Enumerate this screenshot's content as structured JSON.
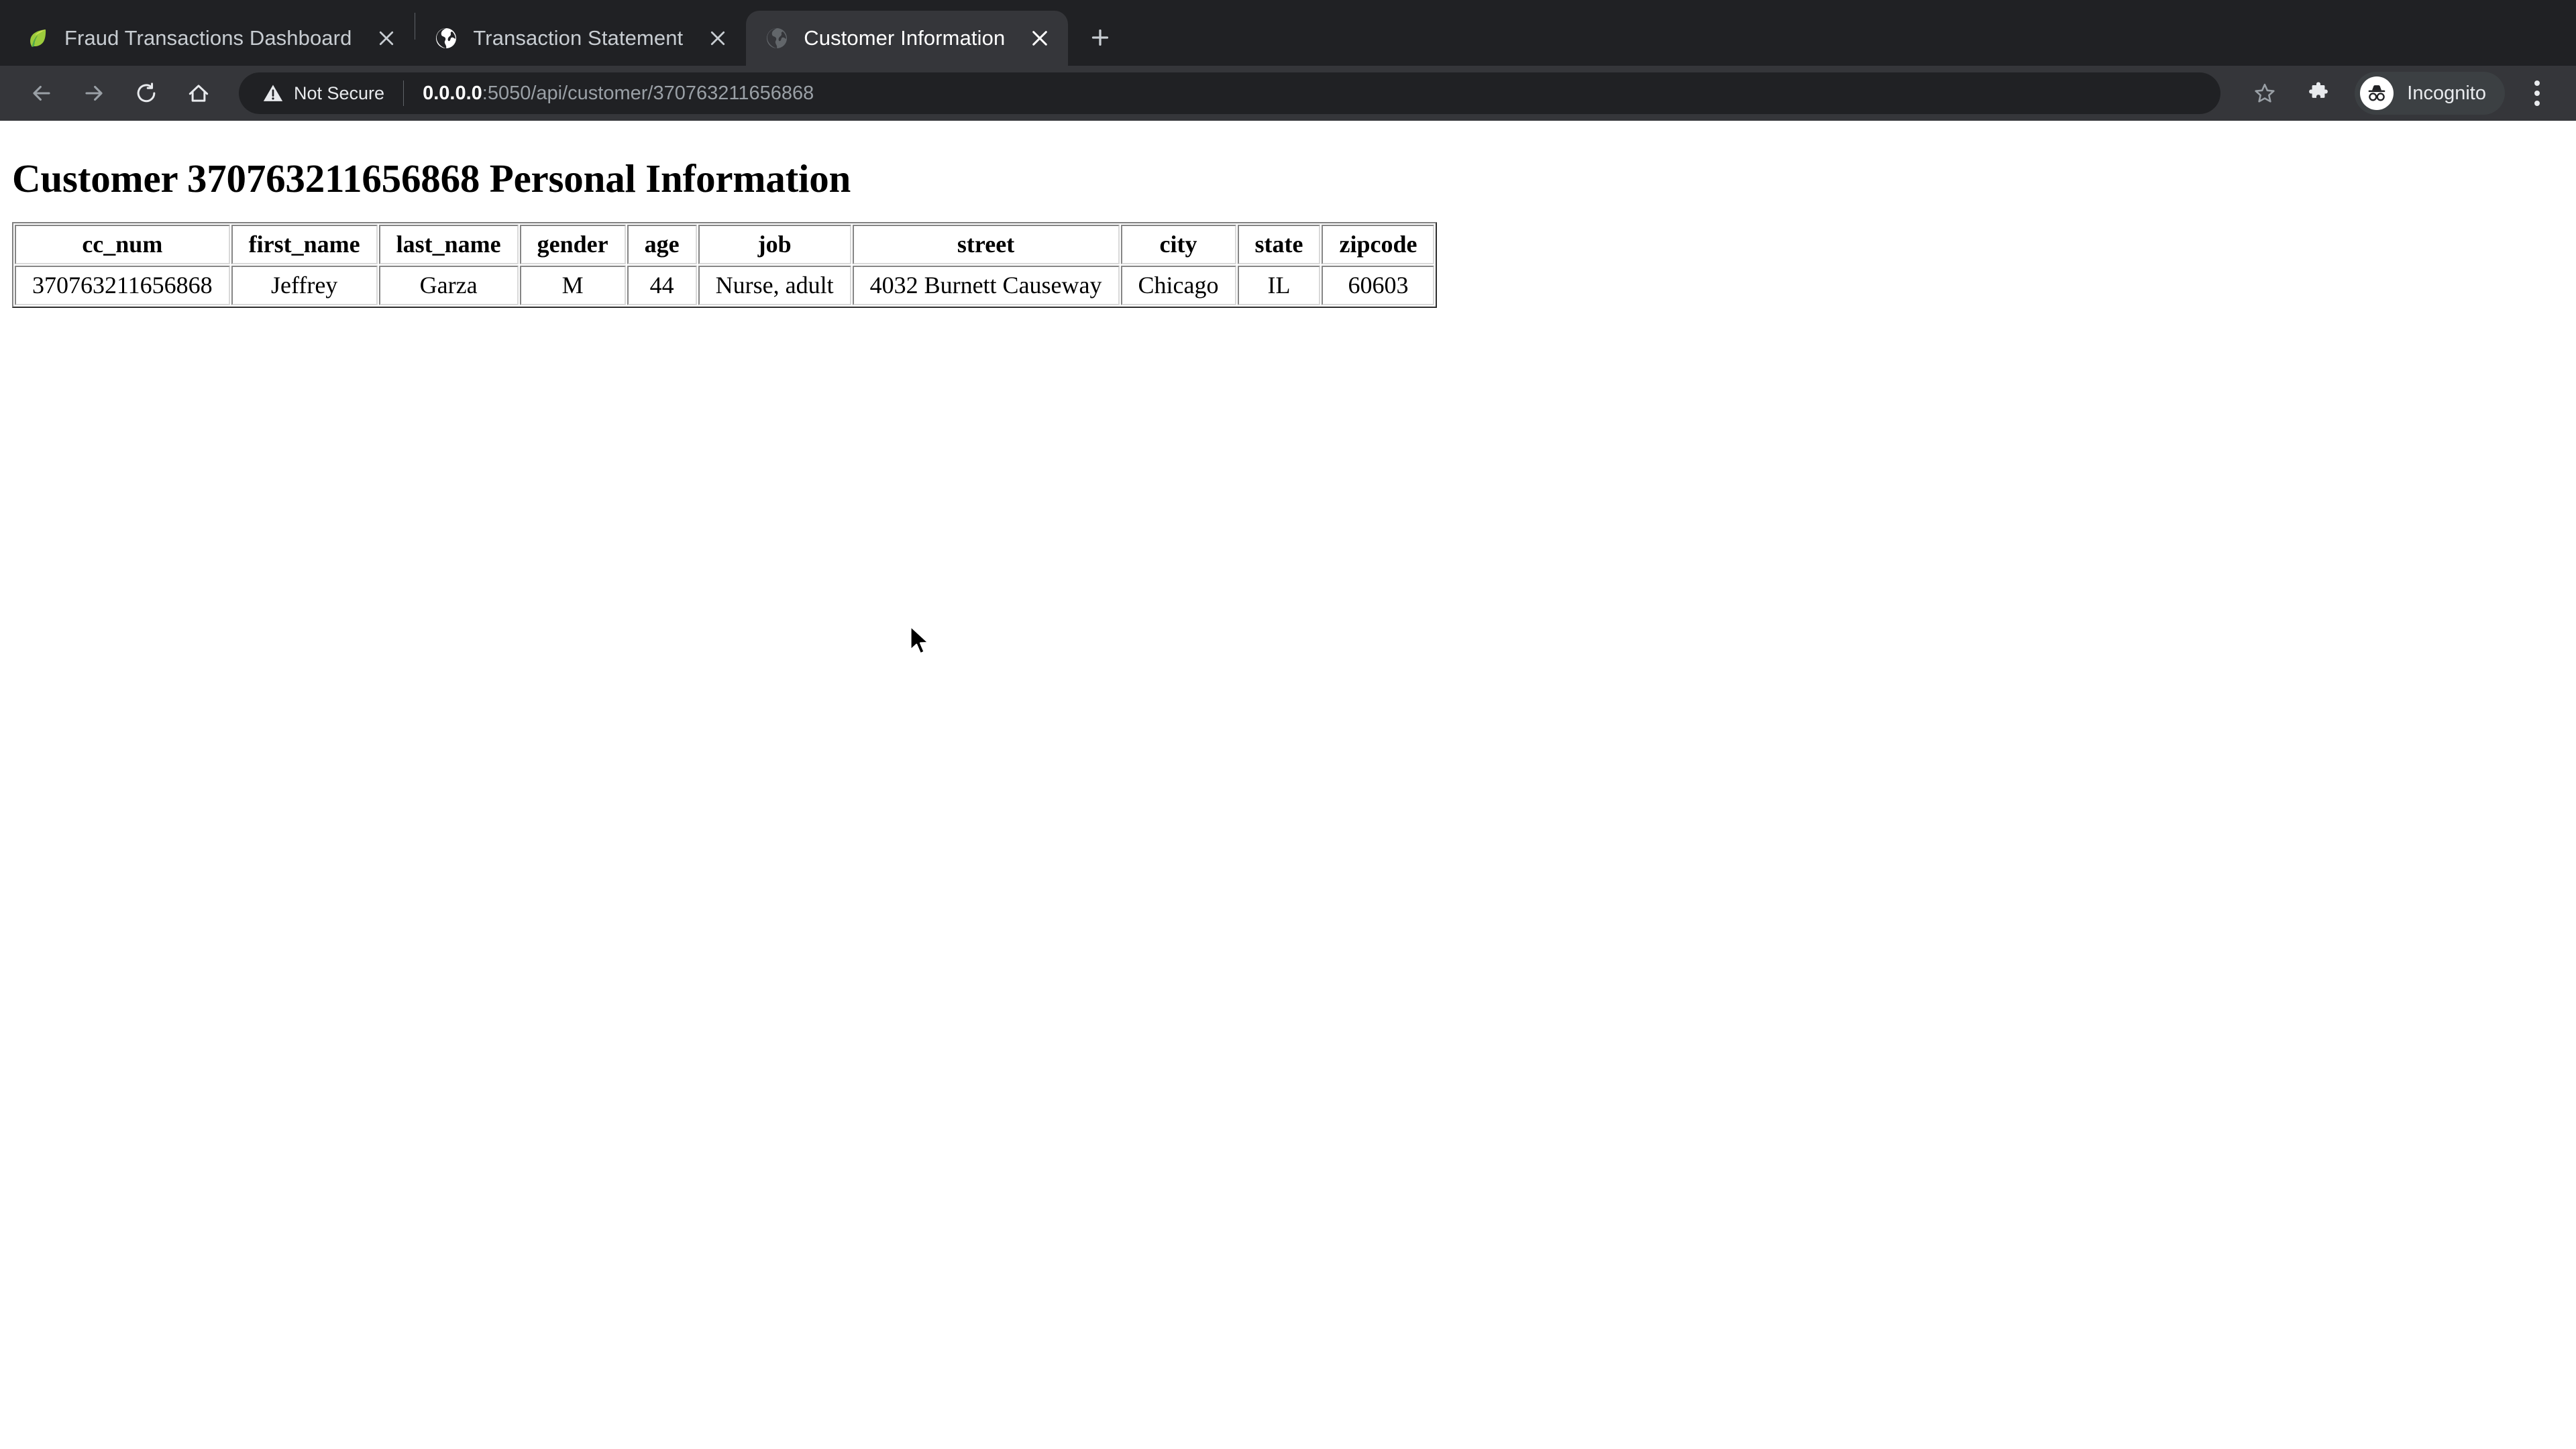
{
  "browser": {
    "tabs": [
      {
        "title": "Fraud Transactions Dashboard",
        "favicon": "leaf-icon",
        "active": false,
        "close_label": "×"
      },
      {
        "title": "Transaction Statement",
        "favicon": "globe-icon",
        "active": false,
        "close_label": "×"
      },
      {
        "title": "Customer Information",
        "favicon": "globe-icon-dim",
        "active": true,
        "close_label": "×"
      }
    ],
    "new_tab_label": "+",
    "toolbar": {
      "back_icon": "back-arrow-icon",
      "forward_icon": "forward-arrow-icon",
      "reload_icon": "reload-icon",
      "home_icon": "home-icon",
      "security_icon": "warning-triangle-icon",
      "security_text": "Not Secure",
      "url_host": "0.0.0.0",
      "url_path": ":5050/api/customer/370763211656868",
      "url_full": "0.0.0.0:5050/api/customer/370763211656868",
      "bookmark_icon": "star-icon",
      "extensions_icon": "puzzle-piece-icon",
      "profile_icon": "incognito-hat-glasses-icon",
      "profile_label": "Incognito",
      "menu_icon": "three-dots-vertical-icon"
    },
    "colors": {
      "tabstrip_bg": "#202124",
      "toolbar_bg": "#35363a",
      "active_tab_bg": "#35363a",
      "omnibox_bg": "#202124",
      "text_primary": "#e8eaed",
      "text_secondary": "#9aa0a6",
      "page_bg": "#ffffff"
    }
  },
  "page": {
    "heading": "Customer 370763211656868 Personal Information",
    "table": {
      "headers": [
        "cc_num",
        "first_name",
        "last_name",
        "gender",
        "age",
        "job",
        "street",
        "city",
        "state",
        "zipcode"
      ],
      "rows": [
        [
          "370763211656868",
          "Jeffrey",
          "Garza",
          "M",
          "44",
          "Nurse, adult",
          "4032 Burnett Causeway",
          "Chicago",
          "IL",
          "60603"
        ]
      ]
    }
  }
}
